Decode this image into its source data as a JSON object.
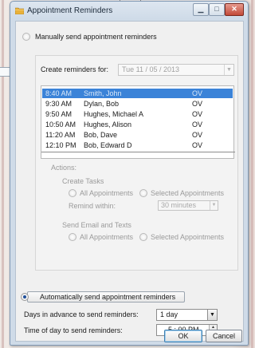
{
  "window": {
    "title": "Appointment Reminders",
    "min_glyph": "▁",
    "max_glyph": "□",
    "close_glyph": "✕"
  },
  "manual": {
    "radio_label": "Manually send appointment reminders",
    "create_for_label": "Create reminders for:",
    "date_value": "Tue   11 / 05 / 2013",
    "appointments": [
      {
        "time": "8:40 AM",
        "name": "Smith, John",
        "type": "OV",
        "selected": true
      },
      {
        "time": "9:30 AM",
        "name": "Dylan, Bob",
        "type": "OV",
        "selected": false
      },
      {
        "time": "9:50 AM",
        "name": "Hughes, Michael A",
        "type": "OV",
        "selected": false
      },
      {
        "time": "10:50 AM",
        "name": "Hughes, Alison",
        "type": "OV",
        "selected": false
      },
      {
        "time": "11:20 AM",
        "name": "Bob, Dave",
        "type": "OV",
        "selected": false
      },
      {
        "time": "12:10 PM",
        "name": "Bob, Edward D",
        "type": "OV",
        "selected": false
      }
    ],
    "actions_label": "Actions:",
    "create_tasks_label": "Create Tasks",
    "all_appointments_label": "All Appointments",
    "selected_appointments_label": "Selected Appointments",
    "remind_within_label": "Remind within:",
    "remind_within_value": "30 minutes",
    "send_email_label": "Send Email and Texts",
    "all_appointments_label_2": "All Appointments",
    "selected_appointments_label_2": "Selected Appointments"
  },
  "auto": {
    "radio_label": "Automatically send appointment reminders",
    "days_label": "Days in advance to send reminders:",
    "days_value": "1 day",
    "time_label": "Time of day to send reminders:",
    "time_value": "5 : 00  PM"
  },
  "buttons": {
    "ok": "OK",
    "cancel": "Cancel"
  },
  "colors": {
    "selection": "#3b83d8",
    "title_bar": "#cfdbe8",
    "close_button": "#c24a38"
  }
}
